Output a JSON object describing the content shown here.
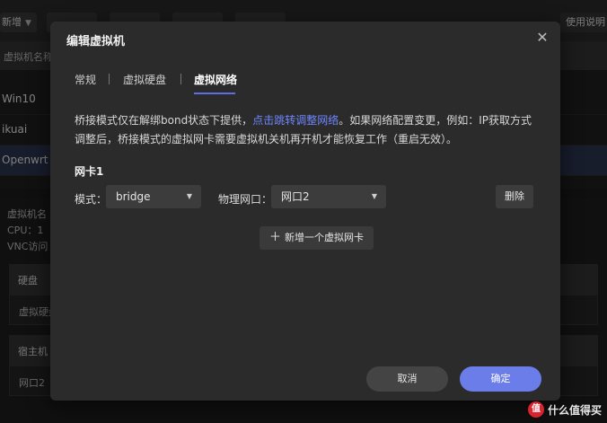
{
  "app": {
    "toolbar": {
      "new_label": "新增",
      "help_label": "使用说明"
    },
    "vm_table": {
      "header": "虚拟机名称",
      "rows": [
        "Win10",
        "ikuai",
        "Openwrt"
      ],
      "selected": "Openwrt"
    },
    "details": {
      "name_label": "虚拟机名",
      "cpu_label": "CPU：1",
      "vnc_label": "VNC访问",
      "disk_section": "硬盘",
      "disk_value": "虚拟硬盘",
      "host_section": "宿主机",
      "host_value": "网口2"
    }
  },
  "dialog": {
    "title": "编辑虚拟机",
    "tabs": [
      "常规",
      "虚拟硬盘",
      "虚拟网络"
    ],
    "active_tab": "虚拟网络",
    "description": {
      "part1": "桥接模式仅在解绑bond状态下提供，",
      "link": "点击跳转调整网络",
      "part2": "。如果网络配置变更，例如：IP获取方式调整后，桥接模式的虚拟网卡需要虚拟机关机再开机才能恢复工作（重启无效）。"
    },
    "nic": {
      "title": "网卡1",
      "mode_label": "模式：",
      "mode_value": "bridge",
      "port_label": "物理网口：",
      "port_value": "网口2",
      "delete_label": "删除"
    },
    "add_nic_label": "新增一个虚拟网卡",
    "cancel_label": "取消",
    "ok_label": "确定"
  },
  "watermark": {
    "badge": "值",
    "text": "什么值得买"
  },
  "colors": {
    "accent": "#6b7de8",
    "link": "#6f86ff",
    "dialog_bg": "#2b2b2b",
    "selected_row": "#2d3550"
  },
  "icons": {
    "close": "close-icon",
    "dropdown": "chevron-down-icon",
    "add": "plus-icon"
  }
}
